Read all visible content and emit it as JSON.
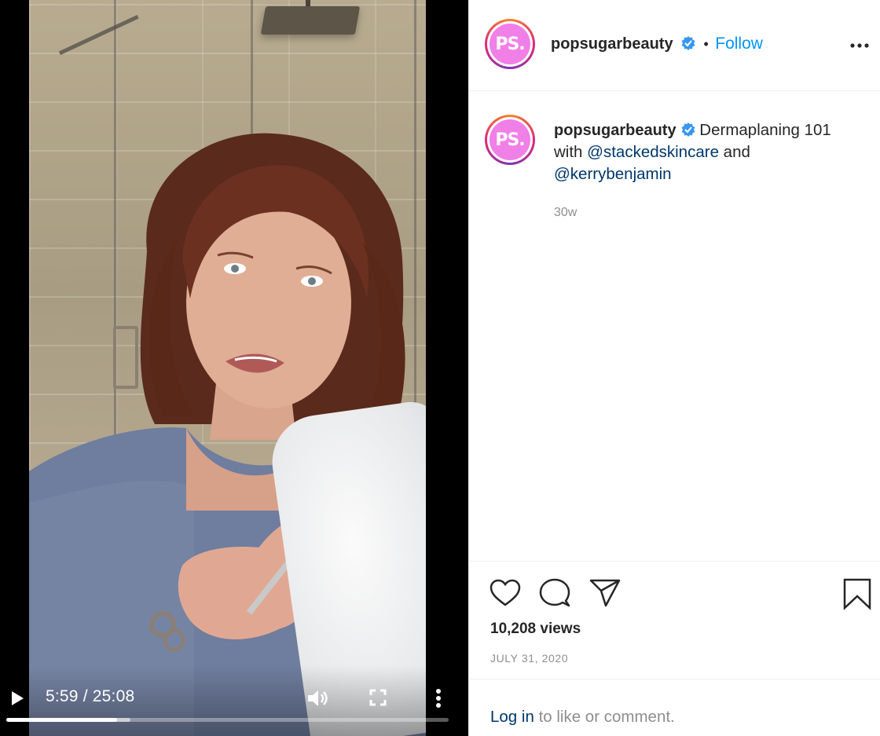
{
  "video": {
    "time_display": "5:59 / 25:08",
    "progress_fraction": 0.25,
    "buffered_fraction": 0.28,
    "controls": {
      "play_icon": "play-icon",
      "volume_icon": "volume-icon",
      "fullscreen_icon": "fullscreen-icon",
      "menu_icon": "more-vertical-icon"
    }
  },
  "header": {
    "avatar_text": "PS.",
    "username": "popsugarbeauty",
    "separator": "•",
    "follow_label": "Follow",
    "more_icon": "more-horizontal-icon"
  },
  "caption": {
    "avatar_text": "PS.",
    "username": "popsugarbeauty",
    "text_before": "Dermaplaning 101 with",
    "mention_1": "@stackedskincare",
    "text_between": "and",
    "mention_2": "@kerrybenjamin",
    "age": "30w"
  },
  "actions": {
    "like_icon": "heart-icon",
    "comment_icon": "comment-icon",
    "share_icon": "share-icon",
    "save_icon": "bookmark-icon"
  },
  "stats": {
    "views": "10,208 views",
    "date": "JULY 31, 2020"
  },
  "footer": {
    "login_link": "Log in",
    "login_text": "to like or comment."
  },
  "colors": {
    "follow_blue": "#0095f6",
    "mention_blue": "#00376b",
    "verified_blue": "#3897f0",
    "avatar_pink": "#f07fe8",
    "muted_gray": "#8e8e8e"
  }
}
